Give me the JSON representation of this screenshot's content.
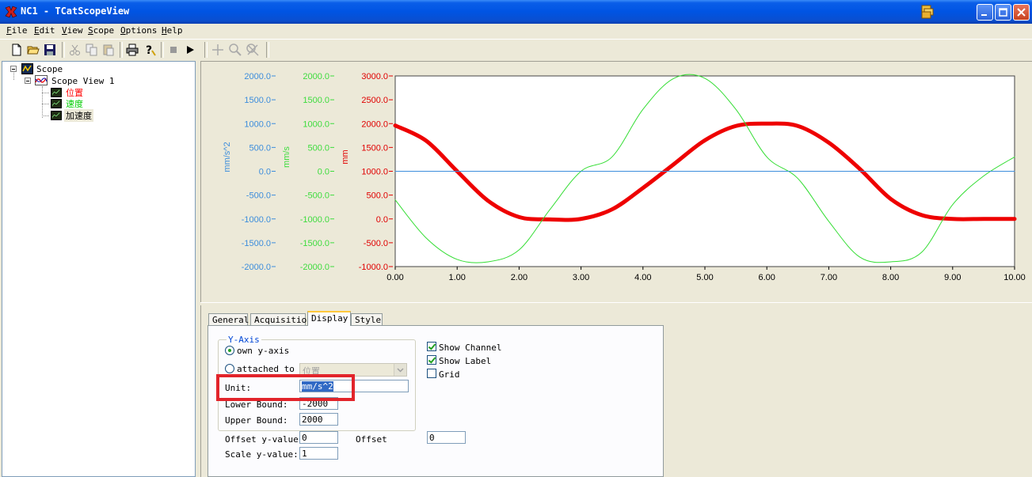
{
  "window": {
    "title": "NC1 - TCatScopeView"
  },
  "menu": [
    {
      "label": "File",
      "key": "F",
      "rest": "ile"
    },
    {
      "label": "Edit",
      "key": "E",
      "rest": "dit"
    },
    {
      "label": "View",
      "key": "V",
      "rest": "iew"
    },
    {
      "label": "Scope",
      "key": "S",
      "rest": "cope"
    },
    {
      "label": "Options",
      "key": "O",
      "rest": "ptions"
    },
    {
      "label": "Help",
      "key": "H",
      "rest": "elp"
    }
  ],
  "toolbar_icons": [
    "new-icon",
    "open-icon",
    "save-icon",
    "cut-icon",
    "copy-icon",
    "paste-icon",
    "print-icon",
    "help-icon",
    "stop-icon",
    "play-icon",
    "crosshair-icon",
    "zoom-icon",
    "zoom-reset-icon"
  ],
  "tree": {
    "root": "Scope",
    "view": "Scope View 1",
    "channels": [
      {
        "label": "位置",
        "color": "#ff0000"
      },
      {
        "label": "速度",
        "color": "#00cc00"
      },
      {
        "label": "加速度",
        "color": "#000000"
      }
    ]
  },
  "chart_data": {
    "type": "line",
    "x_ticks": [
      "0.00",
      "1.00",
      "2.00",
      "3.00",
      "4.00",
      "5.00",
      "6.00",
      "7.00",
      "8.00",
      "9.00",
      "10.00"
    ],
    "xlim": [
      0,
      10
    ],
    "axes": [
      {
        "unit": "mm/s^2",
        "color": "#3c8ddc",
        "ylim": [
          -2000,
          2000
        ],
        "ticks": [
          "2000.0",
          "1500.0",
          "1000.0",
          "500.0",
          "0.0",
          "-500.0",
          "-1000.0",
          "-1500.0",
          "-2000.0"
        ]
      },
      {
        "unit": "mm/s",
        "color": "#3ddc3d",
        "ylim": [
          -2000,
          2000
        ],
        "ticks": [
          "2000.0",
          "1500.0",
          "1000.0",
          "500.0",
          "0.0",
          "-500.0",
          "-1000.0",
          "-1500.0",
          "-2000.0"
        ]
      },
      {
        "unit": "mm",
        "color": "#e00000",
        "ylim": [
          -1000,
          3000
        ],
        "ticks": [
          "3000.0",
          "2500.0",
          "2000.0",
          "1500.0",
          "1000.0",
          "500.0",
          "0.0",
          "-500.0",
          "-1000.0"
        ]
      }
    ],
    "series": [
      {
        "name": "位置",
        "color": "#ee0000",
        "axis": 2,
        "width": 5,
        "x": [
          0,
          0.5,
          1,
          1.5,
          2,
          2.5,
          3,
          3.5,
          4,
          4.5,
          5,
          5.5,
          6,
          6.5,
          7,
          7.5,
          8,
          8.5,
          9,
          9.5,
          10
        ],
        "y": [
          1960,
          1640,
          1000,
          380,
          40,
          -10,
          0,
          200,
          650,
          1150,
          1650,
          1950,
          2000,
          1950,
          1600,
          1050,
          420,
          80,
          0,
          0,
          0
        ]
      },
      {
        "name": "速度",
        "color": "#33dd33",
        "axis": 1,
        "width": 1,
        "x": [
          0,
          0.5,
          1,
          1.5,
          2,
          2.5,
          3,
          3.5,
          4,
          4.5,
          5,
          5.5,
          6,
          6.5,
          7,
          7.5,
          8,
          8.5,
          9,
          9.5,
          10
        ],
        "y": [
          -600,
          -1400,
          -1850,
          -1900,
          -1650,
          -800,
          0,
          300,
          1300,
          1950,
          1950,
          1300,
          300,
          -150,
          -1050,
          -1800,
          -1900,
          -1700,
          -700,
          -100,
          300
        ]
      },
      {
        "name": "加速度",
        "color": "#3c8ddc",
        "axis": 0,
        "width": 1,
        "x": [
          0,
          10
        ],
        "y": [
          0,
          0
        ]
      }
    ]
  },
  "props": {
    "tabs": [
      "General",
      "Acquisition",
      "Display",
      "Style"
    ],
    "active_tab": "Display",
    "yaxis_legend": "Y-Axis",
    "own_label": "own y-axis",
    "attached_label": "attached to",
    "attached_value": "位置",
    "unit_label": "Unit:",
    "unit_value": "mm/s^2",
    "lower_label": "Lower Bound:",
    "lower_value": "-2000",
    "upper_label": "Upper Bound:",
    "upper_value": "2000",
    "offset_y_label": "Offset y-value:",
    "offset_y_value": "0",
    "offset_label": "Offset",
    "offset_value": "0",
    "scale_label": "Scale y-value:",
    "scale_value": "1",
    "show_channel": "Show Channel",
    "show_label": "Show Label",
    "grid": "Grid",
    "show_channel_checked": true,
    "show_label_checked": true,
    "grid_checked": false
  },
  "colors": {
    "highlight": "#e2242b"
  }
}
